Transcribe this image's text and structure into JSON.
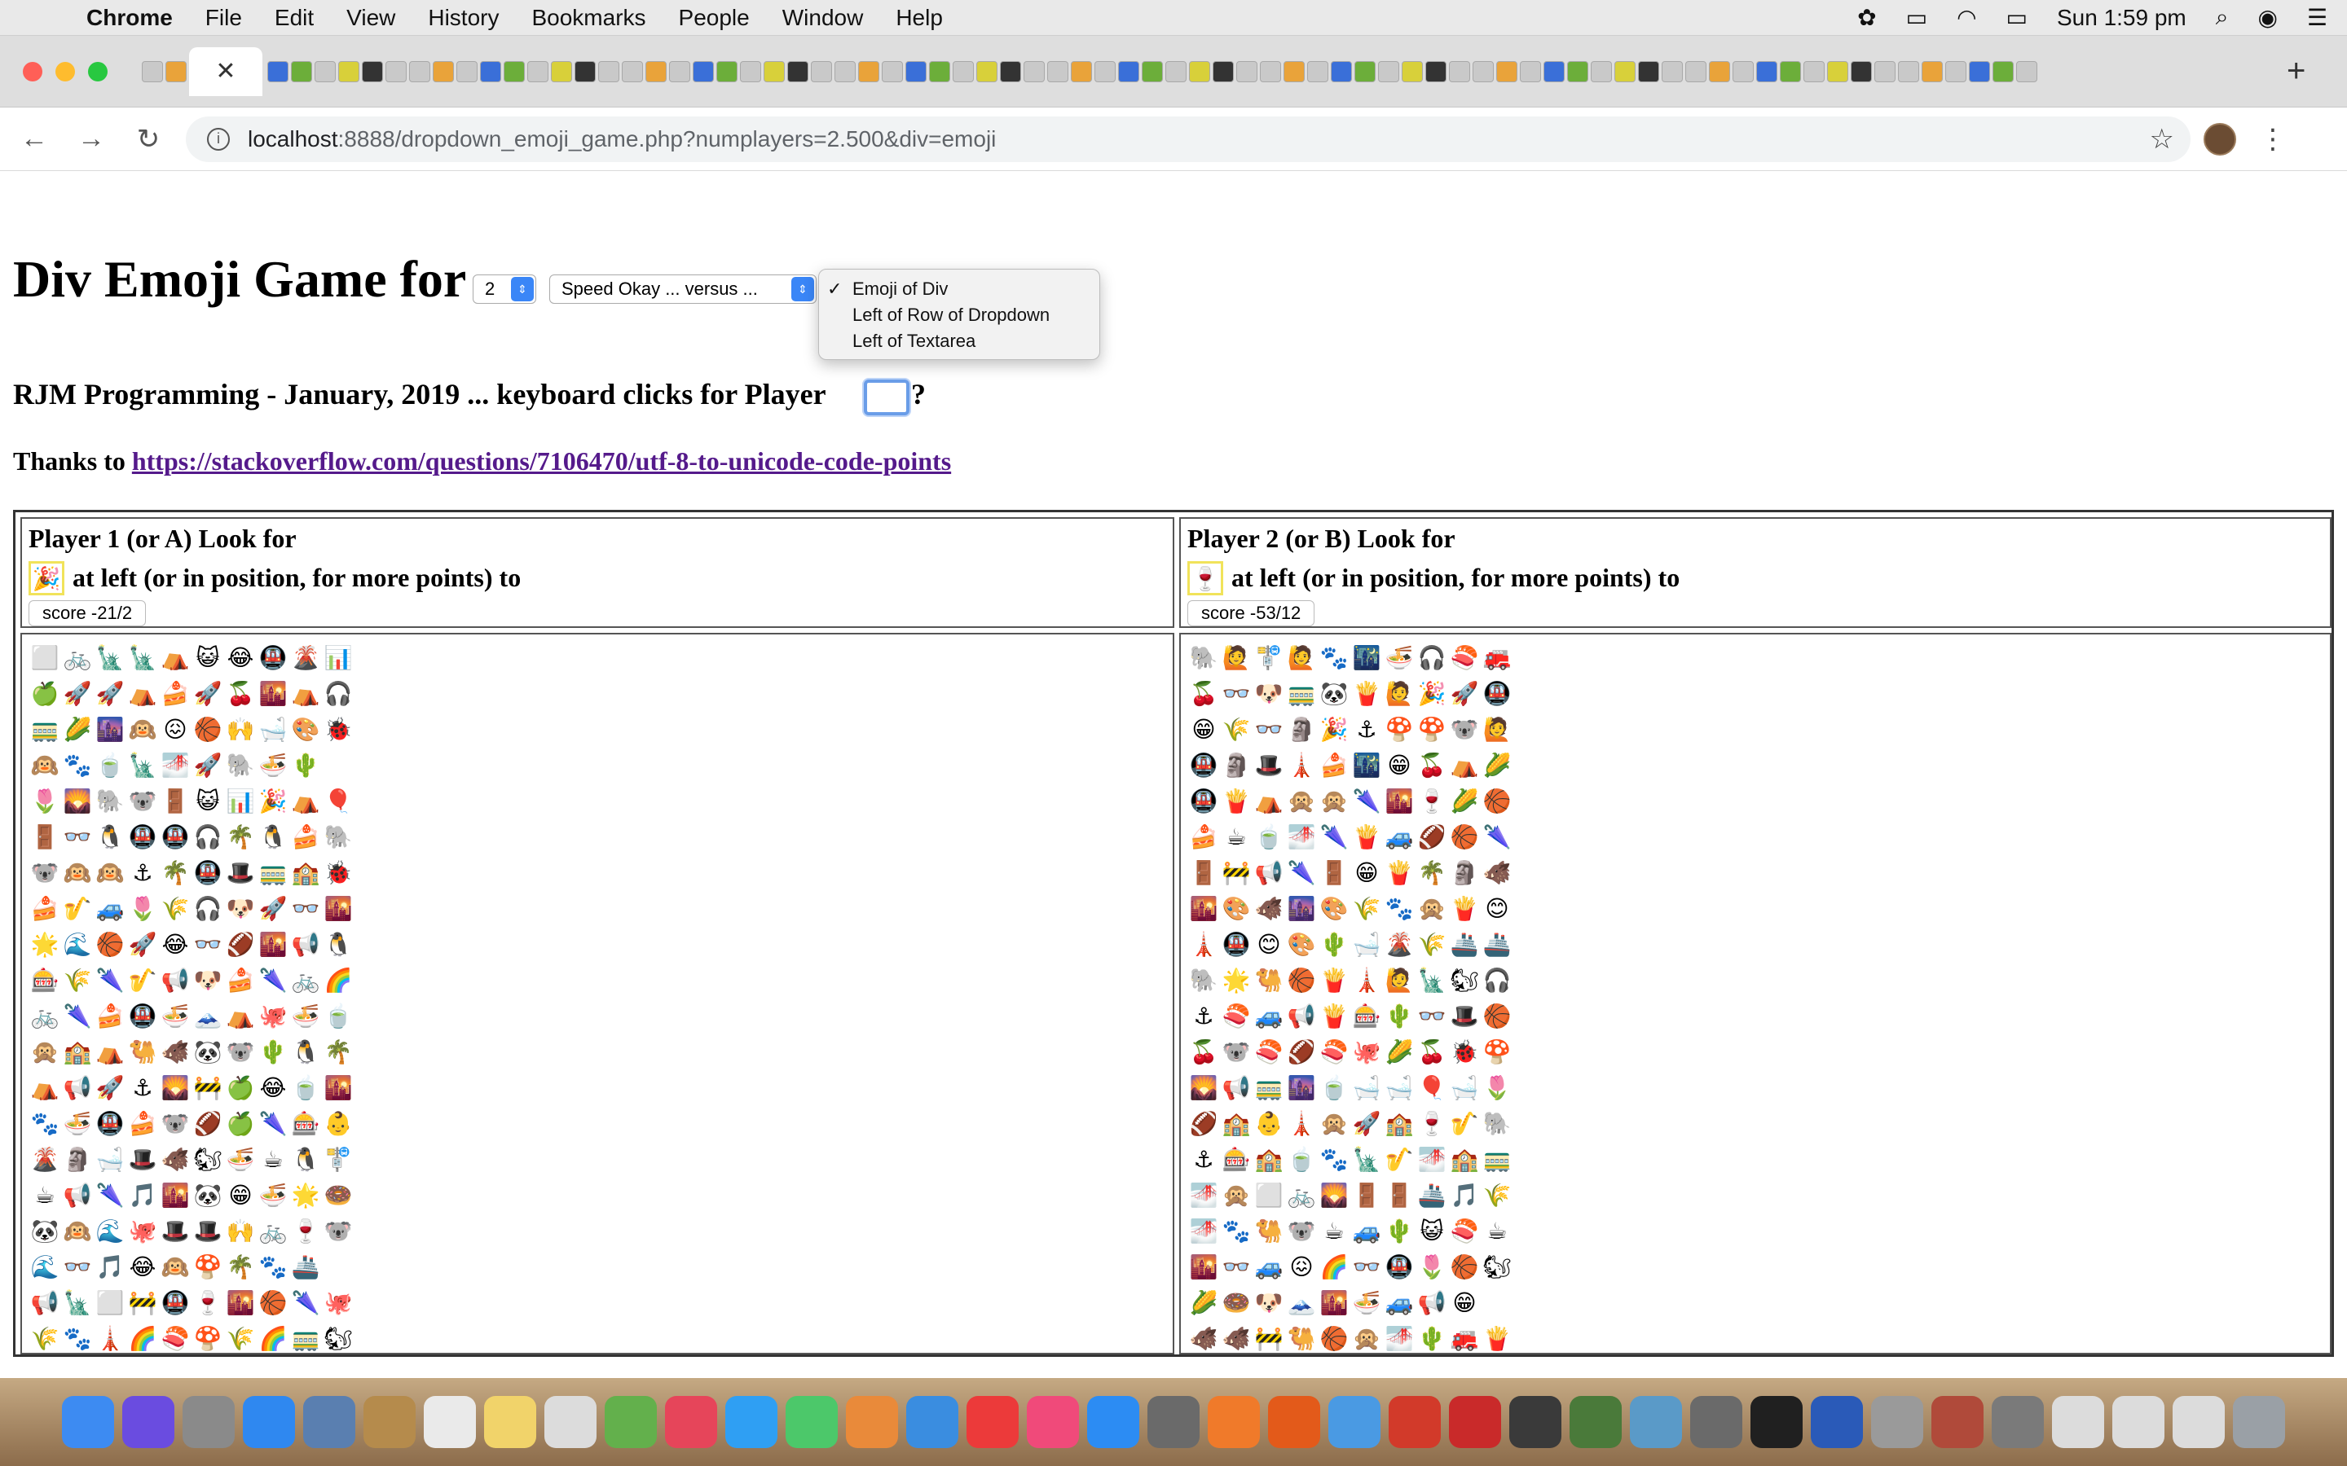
{
  "menubar": {
    "app": "Chrome",
    "items": [
      "File",
      "Edit",
      "View",
      "History",
      "Bookmarks",
      "People",
      "Window",
      "Help"
    ],
    "clock": "Sun 1:59 pm"
  },
  "browser": {
    "url_host": "localhost",
    "url_path": ":8888/dropdown_emoji_game.php?numplayers=2.500&div=emoji",
    "new_tab": "+"
  },
  "page": {
    "title": "Div Emoji Game for",
    "num_players": "2",
    "speed_select": "Speed Okay ... versus ...",
    "mode_options": [
      "Emoji of Div",
      "Left of Row of Dropdown",
      "Left of Textarea"
    ],
    "selected_mode": "Emoji of Div",
    "subtitle": "RJM Programming - January, 2019 ... keyboard clicks for Player",
    "question_mark": "?",
    "thanks_prefix": "Thanks to",
    "thanks_link": "https://stackoverflow.com/questions/7106470/utf-8-to-unicode-code-points"
  },
  "players": [
    {
      "label": "Player 1 (or A) Look for",
      "target_emoji": "🎉",
      "target_text": "at left (or in position, for more points) to",
      "score": "score -21/2",
      "grid": [
        "⬜🚲🗽🗽⛺😺😂🚇🌋📊",
        "🍏🚀🚀⛺🍰🚀🍒🌇⛺🎧",
        "🚃🌽🌆🙉😖🏀🙌🛁🎨🐞",
        "🙉🐾🍵🗽🌁🚀🐘🍜🌵",
        "🌷🌄🐘🐨🚪😺📊🎉⛺🎈",
        "🚪👓🐧🚇🚇🎧🌴🐧🍰🐘",
        "🐨🙉🙉⚓🌴🚇🎩🚃🏫🐞",
        "🍰🎷🚙🌷🌾🎧🐶🚀👓🌇",
        "🌟🌊🏀🚀😂👓🏈🌇📢🐧",
        "🎰🌾🌂🎷📢🐶🍰🌂🚲🌈",
        "🚲🌂🍰🚇🍜🗻⛺🐙🍜🍵",
        "🙊🏫⛺🐫🐗🐼🐨🌵🐧🌴",
        "⛺📢🚀⚓🌄🚧🍏😂🍵🌇",
        "🐾🍜🚇🍰🐨🏈🍏🌂🎰👶",
        "🌋🗿🛁🎩🐗🐿🍜☕🐧🚏",
        "☕📢🌂🎵🌇🐼😁🍜🌟🍩",
        "🐼🙉🌊🐙🎩🎩🙌🚲🍷🐨",
        "🌊👓🎵😂🙉🍄🌴🐾🚢",
        "📢🗽⬜🚧🚇🍷🌇🏀🌂🐙",
        "🌾🐾🗼🌈🍣🍄🌾🌈🚃🐿"
      ]
    },
    {
      "label": "Player 2 (or B) Look for",
      "target_emoji": "🍷",
      "target_text": "at left (or in position, for more points) to",
      "score": "score -53/12",
      "grid": [
        "🐘🙋🚏🙋🐾🌃🍜🎧🍣🚒",
        "🍒👓🐶🚃🐼🍟🙋🎉🚀🚇",
        "😁🌾👓🗿🎉⚓🍄🍄🐨🙋",
        "🚇🗿🎩🗼🍰🌃😁🍒⛺🌽",
        "🚇🍟⛺🙊🙊🌂🌇🍷🌽🏀",
        "🍰☕🍵🌁🌂🍟🚙🏈🏀🌂",
        "🚪🚧📢🌂🚪😁🍟🌴🗿🐗",
        "🌇🎨🐗🌆🎨🌾🐾🙊🍟😊",
        "🗼🚇😊🎨🌵🛁🌋🌾🚢🚢",
        "🐘🌟🐫🏀🍟🗼🙋🗽🐿🎧",
        "⚓🍣🚙📢🍟🎰🌵👓🎩🏀",
        "🍒🐨🍣🏈🍣🐙🌽🍒🐞🍄",
        "🌄📢🚃🌆🍵🛁🛁🎈🛁🌷",
        "🏈🏫👶🗼🙊🚀🏫🍷🎷🐘",
        "⚓🎰🏫🍵🐾🗽🎷🌁🏫🚃",
        "🌁🙊⬜🚲🌄🚪🚪🚢🎵🌾",
        "🌁🐾🐫🐨☕🚙🌵😺🍣☕",
        "🌇👓🚙😖🌈👓🚇🌷🏀🐿",
        "🌽🍩🐶🗻🌇🍜🚙📢😁",
        "🐗🐗🚧🐫🏀🙊🌁🌵🚒🍟"
      ]
    }
  ],
  "colors": {
    "window_bg": "#ffffff",
    "link": "#551a8b",
    "select_accent": "#3a86f7",
    "target_border": "#f1e35a"
  },
  "icons": {
    "apple": "apple-icon",
    "wifi": "wifi-icon",
    "battery": "battery-icon",
    "search": "search-icon"
  }
}
